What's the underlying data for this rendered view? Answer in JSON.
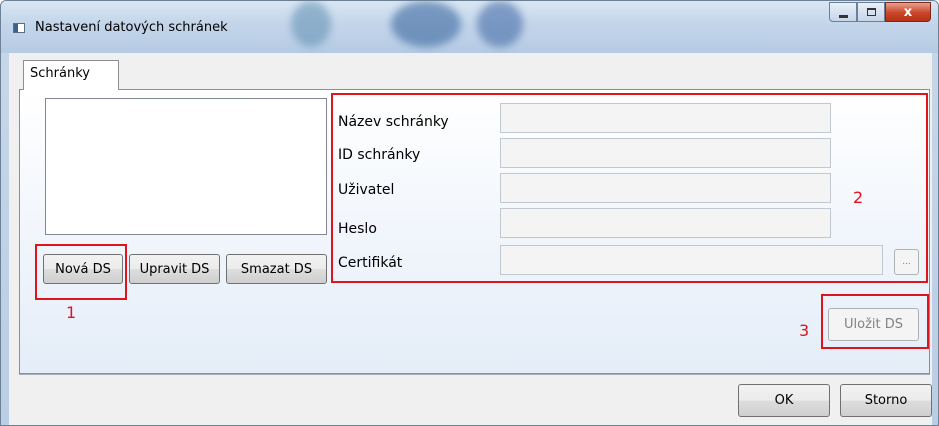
{
  "window": {
    "title": "Nastavení datových schránek",
    "minimize_label": "",
    "maximize_label": "",
    "close_label": "x"
  },
  "tabs": [
    {
      "label": "Schránky",
      "selected": true
    }
  ],
  "left": {
    "buttons": {
      "new": "Nová DS",
      "edit": "Upravit DS",
      "delete": "Smazat DS"
    }
  },
  "form": {
    "fields": [
      {
        "label": "Název schránky",
        "value": ""
      },
      {
        "label": "ID schránky",
        "value": ""
      },
      {
        "label": "Uživatel",
        "value": ""
      },
      {
        "label": "Heslo",
        "value": ""
      },
      {
        "label": "Certifikát",
        "value": ""
      }
    ],
    "browse_label": "...",
    "save_label": "Uložit DS"
  },
  "annotations": {
    "one": "1",
    "two": "2",
    "three": "3"
  },
  "footer": {
    "ok_label": "OK",
    "cancel_label": "Storno"
  }
}
